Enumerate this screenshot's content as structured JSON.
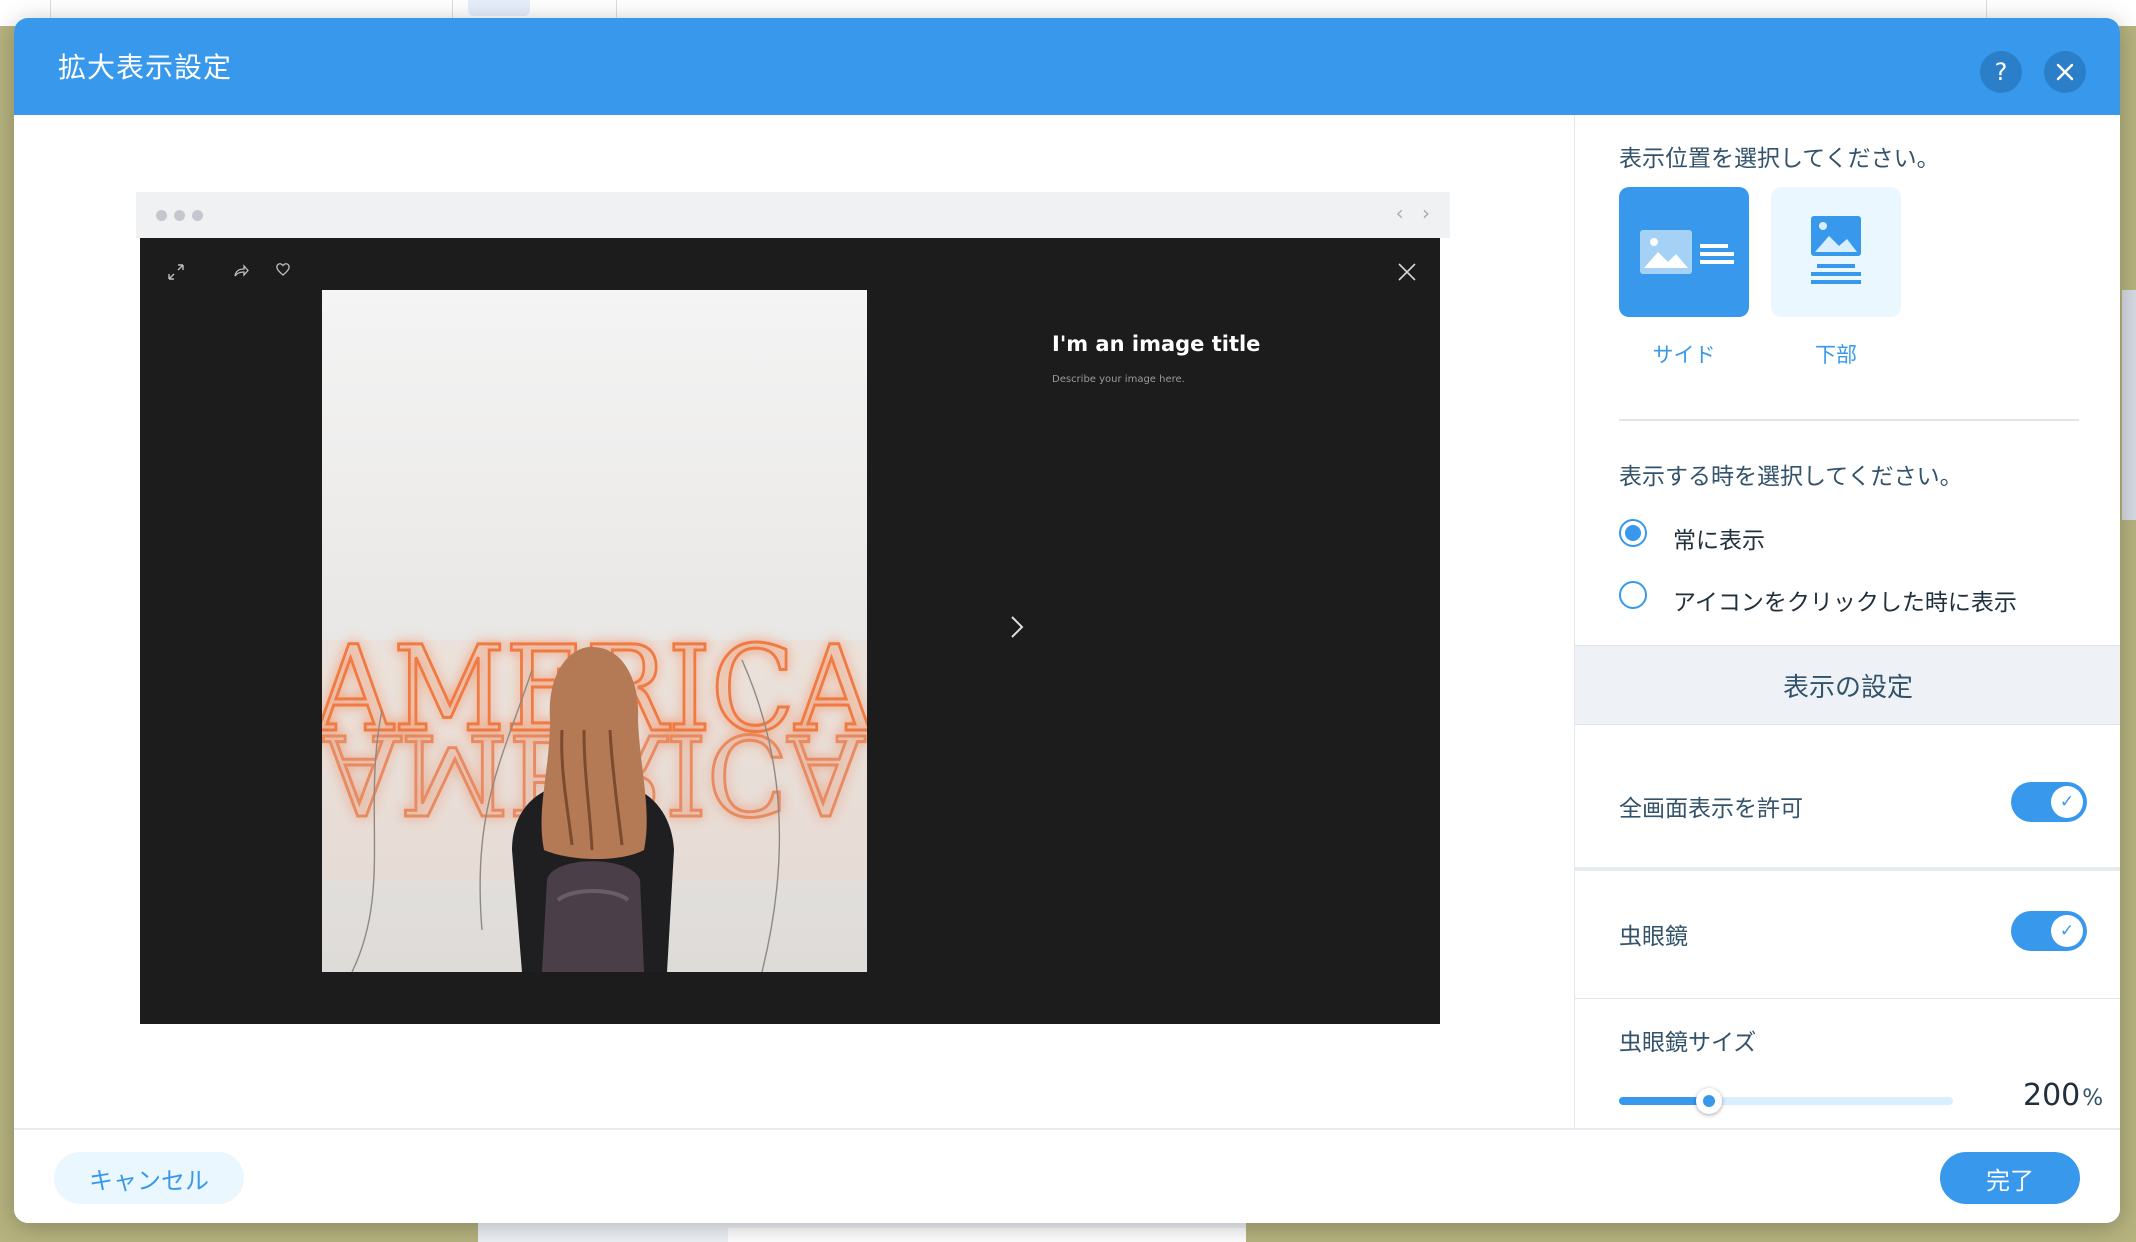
{
  "dialog": {
    "title": "拡大表示設定",
    "help_icon": "help-icon",
    "close_icon": "close-icon"
  },
  "preview": {
    "image_title": "I'm an image title",
    "image_description": "Describe your image here.",
    "photo_text": "AMERICA"
  },
  "settings": {
    "position_prompt": "表示位置を選択してください。",
    "positions": [
      {
        "label": "サイド",
        "selected": true
      },
      {
        "label": "下部",
        "selected": false
      }
    ],
    "show_prompt": "表示する時を選択してください。",
    "show_options": [
      {
        "label": "常に表示",
        "checked": true
      },
      {
        "label": "アイコンをクリックした時に表示",
        "checked": false
      }
    ],
    "section_title": "表示の設定",
    "fullscreen_label": "全画面表示を許可",
    "fullscreen_on": true,
    "magnifier_label": "虫眼鏡",
    "magnifier_on": true,
    "magnifier_size_label": "虫眼鏡サイズ",
    "magnifier_size_value": "200",
    "magnifier_size_unit": "%",
    "magnifier_size_fraction": 0.27
  },
  "footer": {
    "cancel_label": "キャンセル",
    "done_label": "完了"
  },
  "colors": {
    "accent": "#3899ec",
    "lightbox_bg": "#1c1c1c",
    "backdrop": "#b6b37f"
  }
}
